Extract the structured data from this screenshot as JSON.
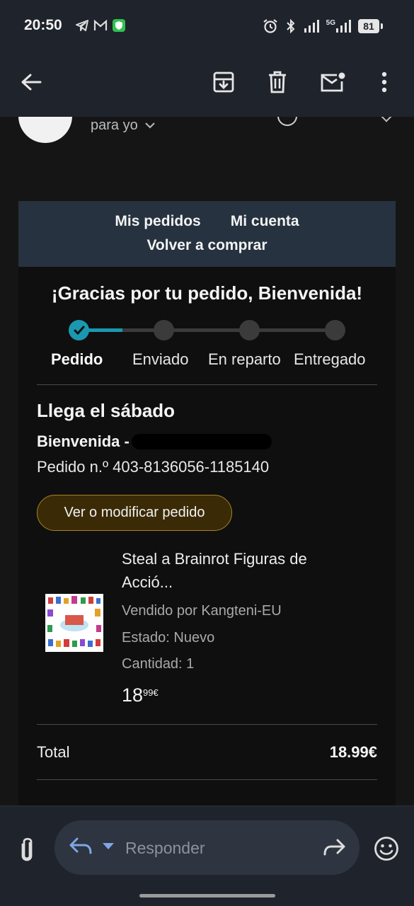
{
  "status_bar": {
    "time": "20:50",
    "network_label": "5G",
    "battery": "81"
  },
  "app_bar": {
    "icons": [
      "back-arrow-icon",
      "archive-icon",
      "delete-icon",
      "mark-unread-icon",
      "more-options-icon"
    ]
  },
  "email_header": {
    "recipient_label": "para yo"
  },
  "email_nav": {
    "link_orders": "Mis pedidos",
    "link_account": "Mi cuenta",
    "link_buy_again": "Volver a comprar"
  },
  "email_body": {
    "thanks_title": "¡Gracias por tu pedido, Bienvenida!",
    "steps": [
      "Pedido",
      "Enviado",
      "En reparto",
      "Entregado"
    ],
    "active_step": 0,
    "arrival": "Llega el sábado",
    "recipient_name": "Bienvenida -",
    "order_number": "Pedido n.º 403-8136056-1185140",
    "view_order_button": "Ver o modificar pedido",
    "product": {
      "title_line1": "Steal a Brainrot Figuras de",
      "title_line2": "Acció...",
      "seller": "Vendido por Kangteni-EU",
      "condition": "Estado: Nuevo",
      "quantity": "Cantidad: 1",
      "price_whole": "18",
      "price_fraction": "99€"
    },
    "total_label": "Total",
    "total_value": "18.99€"
  },
  "reply_bar": {
    "reply_placeholder": "Responder"
  },
  "colors": {
    "accent_teal": "#1a98b0",
    "button_gold_border": "#a88328",
    "nav_box": "#26323f",
    "bar_bg": "#1f232b"
  }
}
